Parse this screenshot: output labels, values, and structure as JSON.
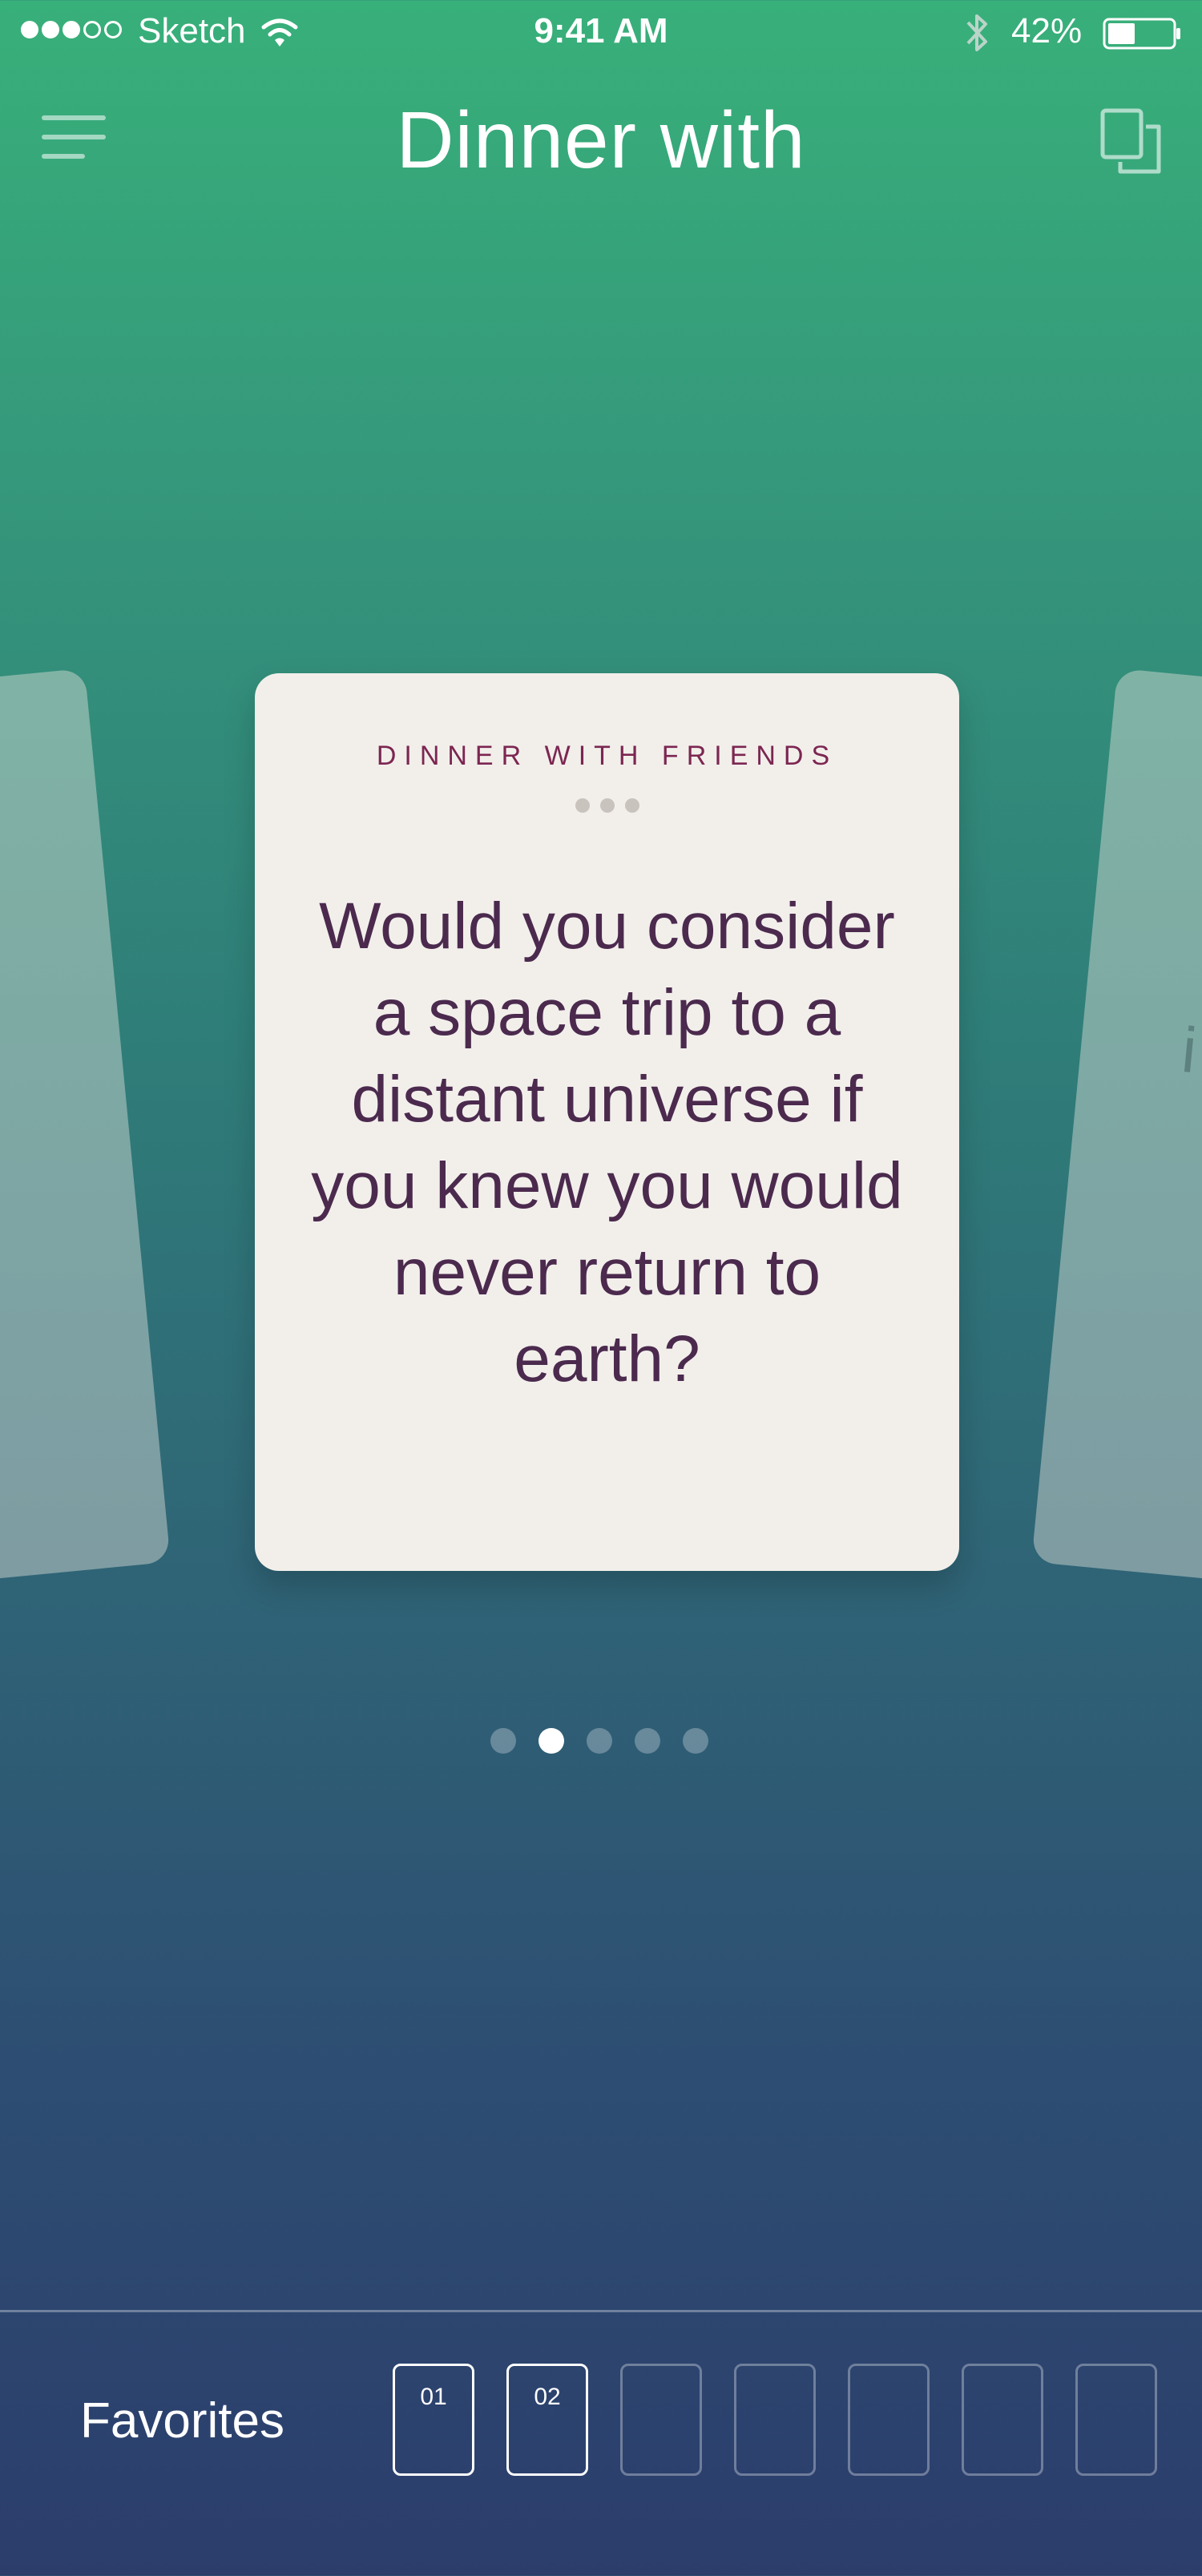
{
  "status_bar": {
    "signal_bars_filled": 3,
    "signal_bars_total": 5,
    "carrier": "Sketch",
    "time": "9:41 AM",
    "battery_percent": "42%",
    "battery_level": 0.42,
    "icons": [
      "wifi-icon",
      "bluetooth-icon",
      "battery-icon"
    ]
  },
  "nav": {
    "title": "Dinner with",
    "menu_icon": "hamburger-menu-icon",
    "cards_icon": "cards-stack-icon"
  },
  "carousel": {
    "main_card": {
      "category": "DINNER WITH FRIENDS",
      "question": "Would you consider a space trip to a distant universe if you knew you would never return to earth?"
    },
    "right_card_visible_text": "i",
    "pages_total": 5,
    "active_page": 2
  },
  "favorites": {
    "label": "Favorites",
    "slots": [
      "01",
      "02",
      "",
      "",
      "",
      "",
      ""
    ]
  },
  "colors": {
    "gradient_top": "#38b07a",
    "gradient_bottom": "#2c3d6c",
    "card_background": "#f2efeb",
    "category_text": "#7c2651",
    "question_text": "#4b2a4e"
  }
}
